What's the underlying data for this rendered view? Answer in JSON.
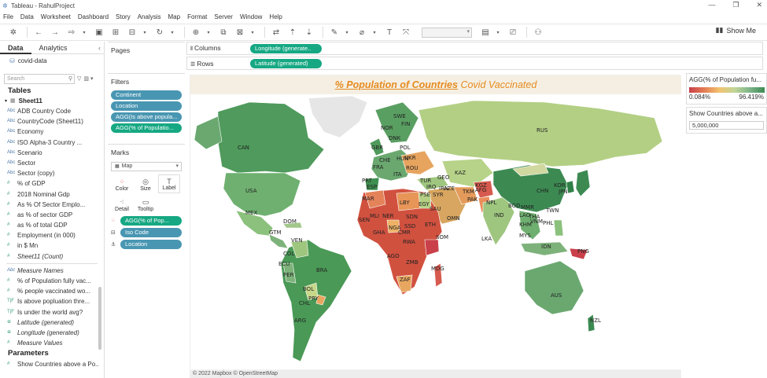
{
  "window": {
    "title": "Tableau - RahulProject"
  },
  "menu": [
    "File",
    "Data",
    "Worksheet",
    "Dashboard",
    "Story",
    "Analysis",
    "Map",
    "Format",
    "Server",
    "Window",
    "Help"
  ],
  "toolbar": {
    "show_me": "Show Me"
  },
  "datapane": {
    "tabs": [
      "Data",
      "Analytics"
    ],
    "datasource": "covid-data",
    "search_placeholder": "Search",
    "tables_heading": "Tables",
    "sheet": "Sheet11",
    "fields": [
      {
        "type": "Abc",
        "label": "ADB Country Code",
        "kind": "dim"
      },
      {
        "type": "Abc",
        "label": "CountryCode (Sheet11)",
        "kind": "dim"
      },
      {
        "type": "Abc",
        "label": "Economy",
        "kind": "dim"
      },
      {
        "type": "Abc",
        "label": "ISO Alpha-3 Country ...",
        "kind": "dim"
      },
      {
        "type": "Abc",
        "label": "Scenario",
        "kind": "dim"
      },
      {
        "type": "Abc",
        "label": "Sector",
        "kind": "dim"
      },
      {
        "type": "Abc",
        "label": "Sector (copy)",
        "kind": "dim"
      },
      {
        "type": "#",
        "label": "% of GDP",
        "kind": "mea"
      },
      {
        "type": "#",
        "label": "2018 Nominal Gdp",
        "kind": "mea"
      },
      {
        "type": "#",
        "label": "As % Of Sector Emplo...",
        "kind": "mea"
      },
      {
        "type": "#",
        "label": "as % of sector GDP",
        "kind": "mea"
      },
      {
        "type": "#",
        "label": "as % of total GDP",
        "kind": "mea"
      },
      {
        "type": "#",
        "label": "Employment (in 000)",
        "kind": "mea"
      },
      {
        "type": "#",
        "label": "in $ Mn",
        "kind": "mea"
      },
      {
        "type": "#",
        "label": "Sheet11 (Count)",
        "kind": "mea",
        "italic": true
      }
    ],
    "extra_fields": [
      {
        "type": "Abc",
        "label": "Measure Names",
        "kind": "dim",
        "italic": true
      },
      {
        "type": "#",
        "label": "% of Population fully vac...",
        "kind": "mea"
      },
      {
        "type": "#",
        "label": "% people vaccinated wo...",
        "kind": "mea"
      },
      {
        "type": "T|F",
        "label": "Is above popluation thre...",
        "kind": "mea"
      },
      {
        "type": "T|F",
        "label": "Is under the world avg?",
        "kind": "mea"
      },
      {
        "type": "⊕",
        "label": "Latitude (generated)",
        "kind": "mea",
        "italic": true
      },
      {
        "type": "⊕",
        "label": "Longitude (generated)",
        "kind": "mea",
        "italic": true
      },
      {
        "type": "#",
        "label": "Measure Values",
        "kind": "mea",
        "italic": true
      }
    ],
    "parameters_heading": "Parameters",
    "parameters": [
      {
        "type": "#",
        "label": "Show Countries above a Po...",
        "kind": "mea"
      }
    ]
  },
  "cards": {
    "pages": "Pages",
    "filters_title": "Filters",
    "filters": [
      "Continent",
      "Location",
      "AGG(Is above popula...",
      "AGG(% of Populatio..."
    ],
    "marks_title": "Marks",
    "mark_type": "Map",
    "mark_buttons": [
      "Color",
      "Size",
      "Label",
      "Detail",
      "Tooltip"
    ],
    "mark_fields": [
      "AGG(% of Pop...",
      "Iso Code",
      "Location"
    ]
  },
  "shelves": {
    "columns_label": "Columns",
    "columns_pill": "Longitude (generate..",
    "rows_label": "Rows",
    "rows_pill": "Latitude (generated)"
  },
  "view": {
    "title_bold": "% Population of Countries",
    "title_rest": "Covid Vaccinated",
    "attribution": "© 2022 Mapbox © OpenStreetMap",
    "country_labels": [
      "CAN",
      "USA",
      "MEX",
      "DOM",
      "GTM",
      "VEN",
      "COL",
      "ECU",
      "BRA",
      "BOL",
      "PER",
      "PRY",
      "CHL",
      "ARG",
      "SWE",
      "NOR",
      "FIN",
      "GBR",
      "DNK",
      "POL",
      "UKR",
      "CHE",
      "HUN",
      "FRA",
      "ITA",
      "PRT",
      "ESP",
      "ROU",
      "TUR",
      "GEO",
      "AZE",
      "KAZ",
      "KGZ",
      "TKM",
      "AFG",
      "PAK",
      "IRN",
      "IRQ",
      "SYR",
      "PSE",
      "LBY",
      "EGY",
      "SAU",
      "OMN",
      "IND",
      "NPL",
      "BGD",
      "MMR",
      "LAO",
      "KHM",
      "MYS",
      "VNM",
      "THA",
      "PHL",
      "TWN",
      "JPN",
      "KOR",
      "CHN",
      "RUS",
      "MAR",
      "MLI",
      "NER",
      "SEN",
      "GHA",
      "NGA",
      "CMR",
      "SDN",
      "SSD",
      "ETH",
      "SOM",
      "RWA",
      "AGO",
      "ZMB",
      "ZAF",
      "MDG",
      "LKA",
      "IDN",
      "PNG",
      "AUS",
      "NZL"
    ]
  },
  "legend": {
    "title": "AGG(% of Population fu...",
    "min": "0.084%",
    "max": "96.419%",
    "colors": [
      "#c9404a",
      "#e47c55",
      "#f2c36f",
      "#c2d597",
      "#7fb58a",
      "#3c8a52"
    ]
  },
  "parameter_control": {
    "title": "Show Countries above a...",
    "value": "5,000,000"
  }
}
